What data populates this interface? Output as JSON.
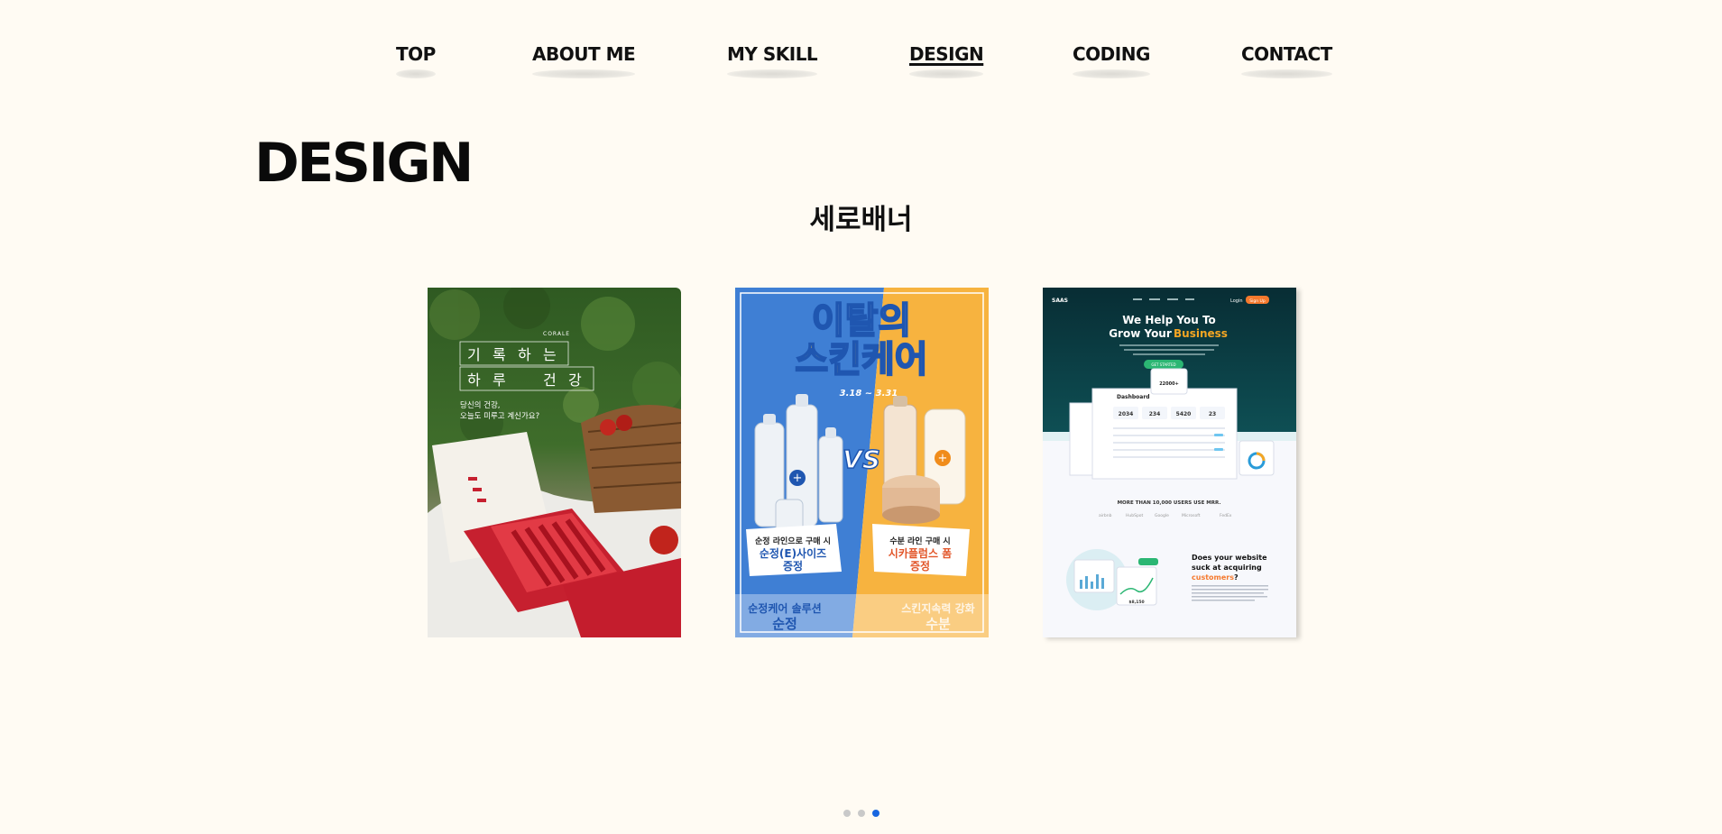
{
  "nav": {
    "items": [
      {
        "label": "TOP"
      },
      {
        "label": "ABOUT ME"
      },
      {
        "label": "MY SKILL"
      },
      {
        "label": "DESIGN"
      },
      {
        "label": "CODING"
      },
      {
        "label": "CONTACT"
      }
    ],
    "active_index": 3
  },
  "section": {
    "title": "DESIGN",
    "subtitle": "세로배너"
  },
  "cards": [
    {
      "brand": "CORALE",
      "headline_row1": [
        "기",
        "록",
        "하",
        "는"
      ],
      "headline_row2": [
        "하",
        "루",
        "건",
        "강"
      ],
      "tagline_line1": "당신의 건강,",
      "tagline_line2": "오늘도 미루고 계신가요?"
    },
    {
      "title_line1": "이탈의",
      "title_line2": "스킨케어",
      "dates": "3.18 ~ 3.31",
      "vs": "VS",
      "left_offer_line1": "순정 라인으로 구매 시",
      "left_offer_line2": "순정(E)사이즈",
      "left_offer_line3": "증정",
      "right_offer_line1": "수분 라인 구매 시",
      "right_offer_line2": "시카플럼스 폼",
      "right_offer_line3": "증정",
      "bottom_left_line1": "순정케어 솔루션",
      "bottom_left_line2": "순정",
      "bottom_right_line1": "스킨지속력 강화",
      "bottom_right_line2": "수분"
    },
    {
      "logo": "SAAS",
      "hero_line1": "We Help You To",
      "hero_line2_prefix": "Grow Your",
      "hero_line2_highlight": "Business",
      "cta": "GET STARTED",
      "login": "Login",
      "signup": "Sign Up",
      "dashboard_title": "Dashboard",
      "stat_1": "2034",
      "stat_2": "234",
      "stat_3": "5420",
      "stat_4": "23",
      "float_value": "22000+",
      "users_line": "MORE THAN 10,000 USERS USE MRR.",
      "brand_1": "airbnb",
      "brand_2": "HubSpot",
      "brand_3": "Google",
      "brand_4": "Microsoft",
      "brand_5": "FedEx",
      "q_line1": "Does your website",
      "q_line2": "suck at acquiring",
      "q_line3_highlight": "customers",
      "q_line3_suffix": "?",
      "mini_value": "$8,150"
    }
  ],
  "pagination": {
    "count": 3,
    "active_index": 2
  },
  "colors": {
    "background": "#fffbf3",
    "text": "#111111",
    "dot_active": "#1866e0",
    "dot_inactive": "#c9c9c9",
    "card2_blue": "#3f7fd4",
    "card2_orange": "#f7b33f",
    "card3_teal": "#0e4f54",
    "card3_accent": "#f5a623"
  }
}
